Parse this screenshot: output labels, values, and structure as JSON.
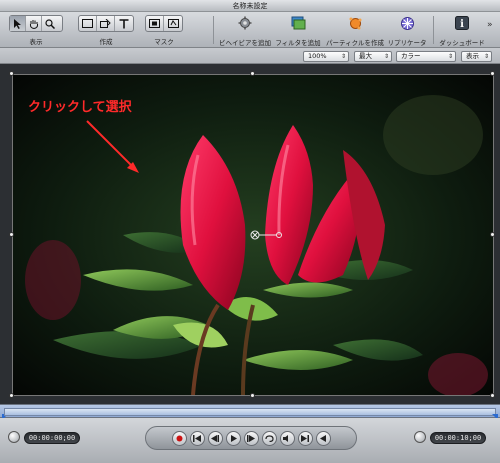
{
  "window": {
    "title": "名称未設定"
  },
  "toolbar": {
    "groups": [
      {
        "label": "表示"
      },
      {
        "label": "作成"
      },
      {
        "label": "マスク"
      }
    ],
    "actions": [
      {
        "label": "ビヘイビアを追加",
        "icon": "gear-behavior-icon"
      },
      {
        "label": "フィルタを追加",
        "icon": "filter-icon"
      },
      {
        "label": "パーティクルを作成",
        "icon": "particle-icon"
      },
      {
        "label": "リプリケータ",
        "icon": "replicator-icon"
      },
      {
        "label": "ダッシュボード",
        "icon": "dashboard-info-icon"
      }
    ],
    "overflow": "»"
  },
  "viewbar": {
    "zoom": "100%",
    "resolution": "最大",
    "channels": "カラー",
    "view": "表示"
  },
  "canvas": {
    "annotation": "クリックして選択",
    "annotation_color": "#ff2a2a"
  },
  "transport": {
    "current_time": "00:00:00;00",
    "duration": "00:00:10;00"
  },
  "colors": {
    "accent_timeline": "#9bb3da",
    "record": "#cc1111"
  }
}
